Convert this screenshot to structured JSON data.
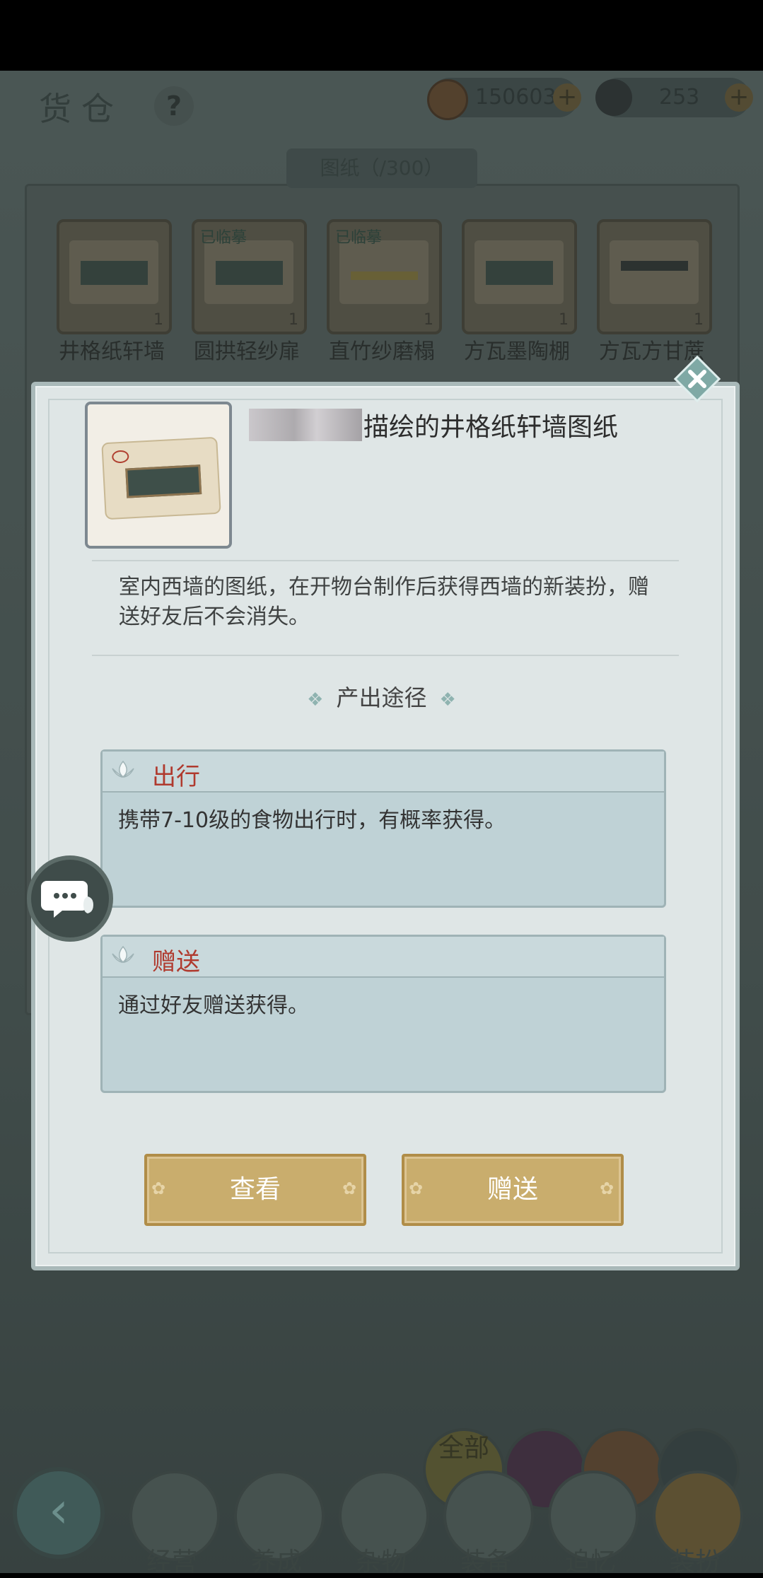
{
  "header": {
    "title": "货仓",
    "help": "?"
  },
  "resources": [
    {
      "name": "coin-icon",
      "value": "150603"
    },
    {
      "name": "silver-icon",
      "value": "253"
    }
  ],
  "inventory": {
    "tab_title": "图纸（/300）",
    "items": [
      {
        "label": "井格纸轩墙",
        "tag": "",
        "count": "1"
      },
      {
        "label": "圆拱轻纱扉",
        "tag": "已临摹",
        "count": "1"
      },
      {
        "label": "直竹纱磨榻",
        "tag": "已临摹",
        "count": "1"
      },
      {
        "label": "方瓦墨陶棚",
        "tag": "",
        "count": "1"
      },
      {
        "label": "方瓦方甘蔗",
        "tag": "",
        "count": "1"
      }
    ]
  },
  "modal": {
    "item_name": "描绘的井格纸轩墙图纸",
    "description": "室内西墙的图纸，在开物台制作后获得西墙的新装扮，赠送好友后不会消失。",
    "source_title": "产出途径",
    "sources": [
      {
        "title": "出行",
        "text": "携带7-10级的食物出行时，有概率获得。"
      },
      {
        "title": "赠送",
        "text": "通过好友赠送获得。"
      }
    ],
    "buttons": {
      "view": "查看",
      "gift": "赠送"
    }
  },
  "categories": {
    "all": "全部"
  },
  "bottom_nav": [
    {
      "label": "经营"
    },
    {
      "label": "养成"
    },
    {
      "label": "杂物"
    },
    {
      "label": "装备"
    },
    {
      "label": "追忆"
    },
    {
      "label": "装扮"
    }
  ],
  "colors": {
    "accent_red": "#b03a2e",
    "button_gold": "#c9ad6d",
    "panel": "#dfe6e6"
  }
}
